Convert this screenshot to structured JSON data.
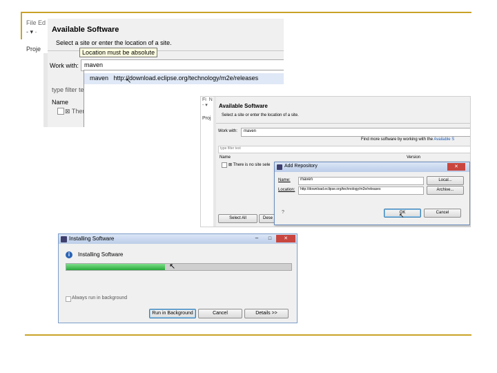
{
  "shot1": {
    "menu_partial": "File Ed",
    "dialog_title": "Available Software",
    "subtitle": "Select a site or enter the location of a site.",
    "error_tooltip": "Location must be absolute",
    "work_with_label": "Work with:",
    "work_with_value": "maven",
    "dropdown_item": "maven   http://download.eclipse.org/technology/m2e/releases",
    "filter_placeholder": "type filter te",
    "name_header": "Name",
    "tree_item_partial": "There",
    "left_tab_partial": "Proje"
  },
  "shot2": {
    "dialog_title": "Available Software",
    "subtitle": "Select a site or enter the location of a site.",
    "work_with_label": "Work with:",
    "work_with_value": "maven",
    "more_software_text": "Find more software by working with the",
    "more_software_link": "Available S",
    "filter_placeholder": "type filter text",
    "name_header": "Name",
    "version_header": "Version",
    "tree_item": "There is no site sele",
    "select_all_button": "Select All",
    "deselect_button": "Dese",
    "left_tab_partial": "Proj",
    "add_repo": {
      "title": "Add Repository",
      "name_label": "Name:",
      "name_value": "maven",
      "location_label": "Location:",
      "location_value": "http://download.eclipse.org/technology/m2e/releases",
      "local_button": "Local...",
      "archive_button": "Archive...",
      "ok_button": "OK",
      "cancel_button": "Cancel",
      "help_glyph": "?"
    }
  },
  "shot3": {
    "window_title": "Installing Software",
    "heading": "Installing Software",
    "progress": 0.44,
    "checkbox_label": "Always run in background",
    "run_bg_button": "Run in Background",
    "cancel_button": "Cancel",
    "details_button": "Details >>"
  },
  "colors": {
    "rule": "#c9a227",
    "progress_green": "#37b24d",
    "title_bar_blue": "#c9d9f0",
    "close_red": "#c8463f"
  }
}
